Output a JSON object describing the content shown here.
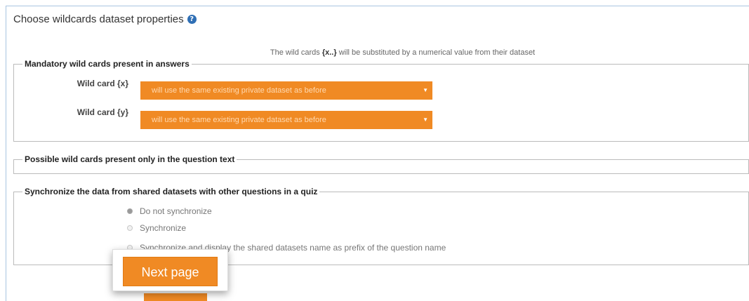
{
  "header": {
    "title": "Choose wildcards dataset properties",
    "help_icon": "question-circle-icon"
  },
  "substitution_note": {
    "before": "The wild cards ",
    "token": "{x..}",
    "after": " will be substituted by a numerical value from their dataset"
  },
  "mandatory": {
    "legend": "Mandatory wild cards present in answers",
    "rows": [
      {
        "label": "Wild card {x}",
        "value": "will use the same existing private dataset as before"
      },
      {
        "label": "Wild card {y}",
        "value": "will use the same existing private dataset as before"
      }
    ]
  },
  "possible": {
    "legend": "Possible wild cards present only in the question text"
  },
  "sync": {
    "legend": "Synchronize the data from shared datasets with other questions in a quiz",
    "options": [
      {
        "label": "Do not synchronize",
        "selected": true
      },
      {
        "label": "Synchronize",
        "selected": false
      },
      {
        "label": "Synchronize and display the shared datasets name as prefix of the question name",
        "selected": false
      }
    ]
  },
  "actions": {
    "next_label": "Next page"
  },
  "colors": {
    "accent": "#f08a24",
    "panel_border": "#a8c4e0",
    "help_icon": "#2f6fb5"
  }
}
